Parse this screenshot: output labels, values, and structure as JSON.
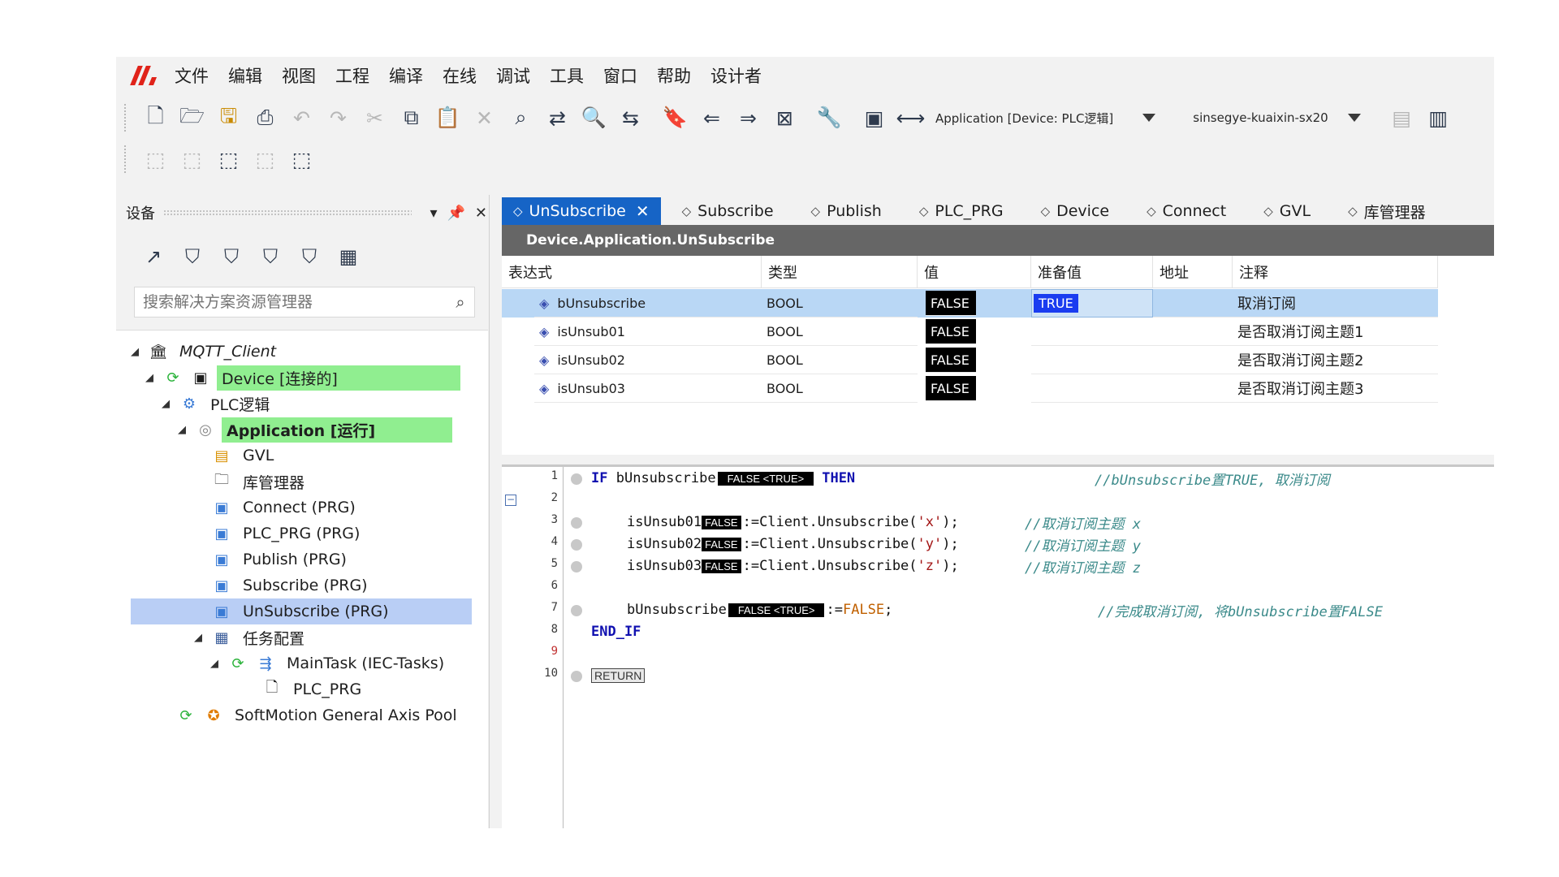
{
  "menu": [
    "文件",
    "编辑",
    "视图",
    "工程",
    "编译",
    "在线",
    "调试",
    "工具",
    "窗口",
    "帮助",
    "设计者"
  ],
  "toolbar": {
    "application_combo": "Application [Device: PLC逻辑]",
    "target_combo": "sinsegye-kuaixin-sx20"
  },
  "left_panel": {
    "title": "设备",
    "search_placeholder": "搜索解决方案资源管理器",
    "tree": {
      "root": "MQTT_Client",
      "device": "Device [连接的]",
      "plc_logic": "PLC逻辑",
      "application": "Application [运行]",
      "gvl": "GVL",
      "library_manager": "库管理器",
      "connect": "Connect (PRG)",
      "plc_prg": "PLC_PRG (PRG)",
      "publish": "Publish (PRG)",
      "subscribe": "Subscribe (PRG)",
      "unsubscribe": "UnSubscribe (PRG)",
      "task_config": "任务配置",
      "main_task": "MainTask (IEC-Tasks)",
      "plc_prg_call": "PLC_PRG",
      "softmotion": "SoftMotion General Axis Pool"
    }
  },
  "tabs": [
    "UnSubscribe",
    "Subscribe",
    "Publish",
    "PLC_PRG",
    "Device",
    "Connect",
    "GVL",
    "库管理器"
  ],
  "editor_title": "Device.Application.UnSubscribe",
  "var_table": {
    "headers": {
      "expr": "表达式",
      "type": "类型",
      "value": "值",
      "prepared": "准备值",
      "address": "地址",
      "comment": "注释"
    },
    "rows": [
      {
        "expr": "bUnsubscribe",
        "type": "BOOL",
        "value": "FALSE",
        "prepared": "TRUE",
        "address": "",
        "comment": "取消订阅"
      },
      {
        "expr": "isUnsub01",
        "type": "BOOL",
        "value": "FALSE",
        "prepared": "",
        "address": "",
        "comment": "是否取消订阅主题1"
      },
      {
        "expr": "isUnsub02",
        "type": "BOOL",
        "value": "FALSE",
        "prepared": "",
        "address": "",
        "comment": "是否取消订阅主题2"
      },
      {
        "expr": "isUnsub03",
        "type": "BOOL",
        "value": "FALSE",
        "prepared": "",
        "address": "",
        "comment": "是否取消订阅主题3"
      }
    ]
  },
  "code": {
    "line_numbers": [
      "1",
      "2",
      "3",
      "4",
      "5",
      "6",
      "7",
      "8",
      "9",
      "10"
    ],
    "l1_kw_if": "IF",
    "l1_var": "bUnsubscribe",
    "l1_mon": "FALSE <TRUE>",
    "l1_kw_then": "THEN",
    "l1_comment": "//bUnsubscribe置TRUE, 取消订阅",
    "l3_var": "isUnsub01",
    "l3_mon": "FALSE",
    "l3_rest": ":=Client.Unsubscribe(",
    "l3_str": "'x'",
    "l3_end": ");",
    "l3_comment": "//取消订阅主题 x",
    "l4_var": "isUnsub02",
    "l4_mon": "FALSE",
    "l4_rest": ":=Client.Unsubscribe(",
    "l4_str": "'y'",
    "l4_end": ");",
    "l4_comment": "//取消订阅主题 y",
    "l5_var": "isUnsub03",
    "l5_mon": "FALSE",
    "l5_rest": ":=Client.Unsubscribe(",
    "l5_str": "'z'",
    "l5_end": ");",
    "l5_comment": "//取消订阅主题 z",
    "l7_var": "bUnsubscribe",
    "l7_mon": "FALSE <TRUE>",
    "l7_assign": ":=",
    "l7_false": "FALSE",
    "l7_semi": ";",
    "l7_comment": "//完成取消订阅, 将bUnsubscribe置FALSE",
    "l8_kw": "END_IF",
    "l10_return": "RETURN"
  },
  "colors": {
    "tab_active": "#1664c6",
    "title_bar": "#666666",
    "status_green": "#90ee90",
    "selection": "#b9cef5",
    "prepared_value": "#1a3cf0",
    "logo": "#e0231a"
  }
}
